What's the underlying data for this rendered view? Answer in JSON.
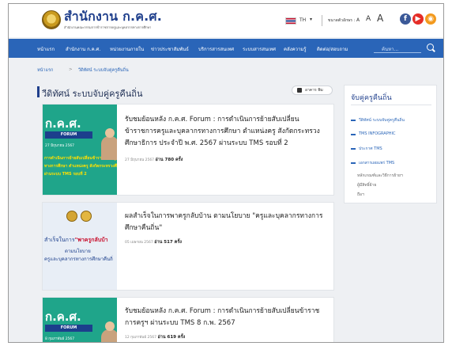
{
  "header": {
    "logo_title": "สำนักงาน ก.ค.ศ.",
    "logo_subtitle": "สำนักงานคณะกรรมการข้าราชการครูและบุคลากรทางการศึกษา",
    "language": "TH",
    "font_size_label": "ขนาดตัวอักษร :",
    "font_small": "A",
    "font_medium": "A",
    "font_large": "A",
    "social": [
      "facebook-icon",
      "youtube-icon",
      "rss-icon"
    ]
  },
  "nav": {
    "items": [
      "หน้าแรก",
      "สำนักงาน ก.ค.ศ.",
      "หน่วยงานภายใน",
      "ข่าวประชาสัมพันธ์",
      "บริการสารสนเทศ",
      "ระบบสารสนเทศ",
      "คลังความรู้",
      "ติดต่อ/สอบถาม"
    ],
    "search_placeholder": "ค้นหา..."
  },
  "breadcrumb": [
    "หน้าแรก",
    ">",
    "วีดิทัศน์ ระบบจับคู่ครูคืนถิ่น"
  ],
  "page": {
    "title": "วีดิทัศน์ ระบบจับคู่ครูคืนถิ่น",
    "print_label": "อาคาร พิม"
  },
  "cards": [
    {
      "thumb_title": "ก.ค.ศ.",
      "thumb_band": "FORUM",
      "thumb_date": "27 มิถุนายน 2567",
      "thumb_lines": [
        "การดำเนินการย้ายสับเปลี่ยนข้าราชการครูและบุคลากร",
        "ทางการศึกษา ตำแหน่งครู สังกัดกระทรวงศึกษาธิการ ประจำปี",
        "ผ่านระบบ TMS รอบที่ 2"
      ],
      "title": "รับชมย้อนหลัง ก.ค.ศ. Forum : การดำเนินการย้ายสับเปลี่ยนข้าราชการครูและบุคลากรทางการศึกษา ตำแหน่งครู สังกัดกระทรวงศึกษาธิการ ประจำปี พ.ศ. 2567 ผ่านระบบ TMS รอบที่ 2",
      "date": "27 มิถุนายน 2567",
      "views": "อ่าน 780 ครั้ง"
    },
    {
      "thumb_line1_pre": "สำเร็จในการ",
      "thumb_line1_em": "\"พาครูกลับบ้า",
      "thumb_line2": "ตามนโยบาย",
      "thumb_line3": "ครูและบุคลากรทางการศึกษาคืนถิ่",
      "title": "ผลสำเร็จในการพาครูกลับบ้าน ตามนโยบาย \"ครูและบุคลากรทางการศึกษาคืนถิ่น\"",
      "date": "05 เมษายน 2567",
      "views": "อ่าน 517 ครั้ง"
    },
    {
      "thumb_title": "ก.ค.ศ.",
      "thumb_band": "FORUM",
      "thumb_date": "8 กุมภาพันธ์ 2567",
      "title": "รับชมย้อนหลัง ก.ค.ศ. Forum : การดำเนินการย้ายสับเปลี่ยนข้าราชการครูฯ ผ่านระบบ TMS 8 ก.พ. 2567",
      "date": "12 กุมภาพันธ์ 2567",
      "views": "อ่าน 619 ครั้ง"
    }
  ],
  "sidebar": {
    "title": "จับคู่ครูคืนถิ่น",
    "items": [
      "วีดิทัศน์ ระบบจับคู่ครูคืนถิ่น",
      "TMS INFOGRAPHIC",
      "ประกาศ TMS",
      "เอกสารเผยแพร่ TMS"
    ],
    "subtext": [
      "หลักเกณฑ์และวิธีการย้ายฯ",
      "ผู้มีสิทธิ์ย้าย",
      "ถือฯ"
    ]
  },
  "colors": {
    "brand_blue": "#1f3f8c",
    "nav_blue": "#2a65b8",
    "thumb_green": "#1fa58a"
  }
}
